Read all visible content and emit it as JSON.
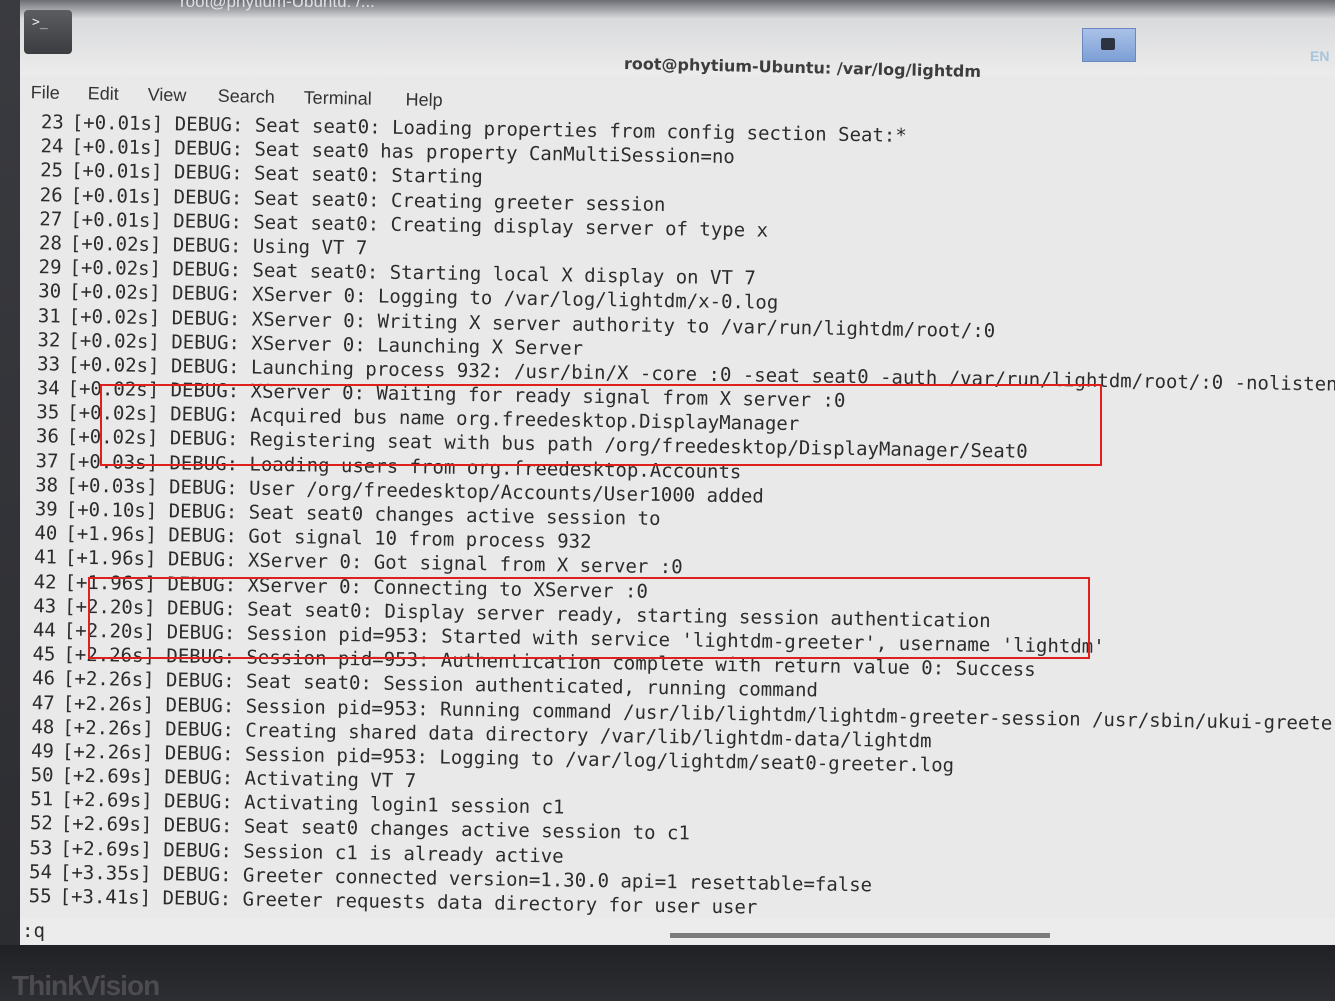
{
  "taskbar": {
    "window_label": "root@phytium-Ubuntu: /...",
    "terminal_icon": "terminal-icon",
    "terminal_glyph": ">_",
    "lang": "EN"
  },
  "window": {
    "title": "root@phytium-Ubuntu: /var/log/lightdm"
  },
  "menu": {
    "items": [
      "File",
      "Edit",
      "View",
      "Search",
      "Terminal",
      "Help"
    ]
  },
  "log": {
    "lines": [
      {
        "n": "23",
        "t": "[+0.01s] DEBUG: Seat seat0: Loading properties from config section Seat:*"
      },
      {
        "n": "24",
        "t": "[+0.01s] DEBUG: Seat seat0 has property CanMultiSession=no"
      },
      {
        "n": "25",
        "t": "[+0.01s] DEBUG: Seat seat0: Starting"
      },
      {
        "n": "26",
        "t": "[+0.01s] DEBUG: Seat seat0: Creating greeter session"
      },
      {
        "n": "27",
        "t": "[+0.01s] DEBUG: Seat seat0: Creating display server of type x"
      },
      {
        "n": "28",
        "t": "[+0.02s] DEBUG: Using VT 7"
      },
      {
        "n": "29",
        "t": "[+0.02s] DEBUG: Seat seat0: Starting local X display on VT 7"
      },
      {
        "n": "30",
        "t": "[+0.02s] DEBUG: XServer 0: Logging to /var/log/lightdm/x-0.log"
      },
      {
        "n": "31",
        "t": "[+0.02s] DEBUG: XServer 0: Writing X server authority to /var/run/lightdm/root/:0"
      },
      {
        "n": "32",
        "t": "[+0.02s] DEBUG: XServer 0: Launching X Server"
      },
      {
        "n": "33",
        "t": "[+0.02s] DEBUG: Launching process 932: /usr/bin/X -core :0 -seat seat0 -auth /var/run/lightdm/root/:0 -nolisten"
      },
      {
        "n": "34",
        "t": "[+0.02s] DEBUG: XServer 0: Waiting for ready signal from X server :0"
      },
      {
        "n": "35",
        "t": "[+0.02s] DEBUG: Acquired bus name org.freedesktop.DisplayManager"
      },
      {
        "n": "36",
        "t": "[+0.02s] DEBUG: Registering seat with bus path /org/freedesktop/DisplayManager/Seat0"
      },
      {
        "n": "37",
        "t": "[+0.03s] DEBUG: Loading users from org.freedesktop.Accounts"
      },
      {
        "n": "38",
        "t": "[+0.03s] DEBUG: User /org/freedesktop/Accounts/User1000 added"
      },
      {
        "n": "39",
        "t": "[+0.10s] DEBUG: Seat seat0 changes active session to"
      },
      {
        "n": "40",
        "t": "[+1.96s] DEBUG: Got signal 10 from process 932"
      },
      {
        "n": "41",
        "t": "[+1.96s] DEBUG: XServer 0: Got signal from X server :0"
      },
      {
        "n": "42",
        "t": "[+1.96s] DEBUG: XServer 0: Connecting to XServer :0"
      },
      {
        "n": "43",
        "t": "[+2.20s] DEBUG: Seat seat0: Display server ready, starting session authentication"
      },
      {
        "n": "44",
        "t": "[+2.20s] DEBUG: Session pid=953: Started with service 'lightdm-greeter', username 'lightdm'"
      },
      {
        "n": "45",
        "t": "[+2.26s] DEBUG: Session pid=953: Authentication complete with return value 0: Success"
      },
      {
        "n": "46",
        "t": "[+2.26s] DEBUG: Seat seat0: Session authenticated, running command"
      },
      {
        "n": "47",
        "t": "[+2.26s] DEBUG: Session pid=953: Running command /usr/lib/lightdm/lightdm-greeter-session /usr/sbin/ukui-greeter"
      },
      {
        "n": "48",
        "t": "[+2.26s] DEBUG: Creating shared data directory /var/lib/lightdm-data/lightdm"
      },
      {
        "n": "49",
        "t": "[+2.26s] DEBUG: Session pid=953: Logging to /var/log/lightdm/seat0-greeter.log"
      },
      {
        "n": "50",
        "t": "[+2.69s] DEBUG: Activating VT 7"
      },
      {
        "n": "51",
        "t": "[+2.69s] DEBUG: Activating login1 session c1"
      },
      {
        "n": "52",
        "t": "[+2.69s] DEBUG: Seat seat0 changes active session to c1"
      },
      {
        "n": "53",
        "t": "[+2.69s] DEBUG: Session c1 is already active"
      },
      {
        "n": "54",
        "t": "[+3.35s] DEBUG: Greeter connected version=1.30.0 api=1 resettable=false"
      },
      {
        "n": "55",
        "t": "[+3.41s] DEBUG: Greeter requests data directory for user user"
      }
    ]
  },
  "command_line": ":q",
  "monitor": {
    "brand": "ThinkVision"
  },
  "colors": {
    "highlight_box": "#e0201d",
    "terminal_bg": "#e9e9e9",
    "text": "#2c2c2c"
  }
}
